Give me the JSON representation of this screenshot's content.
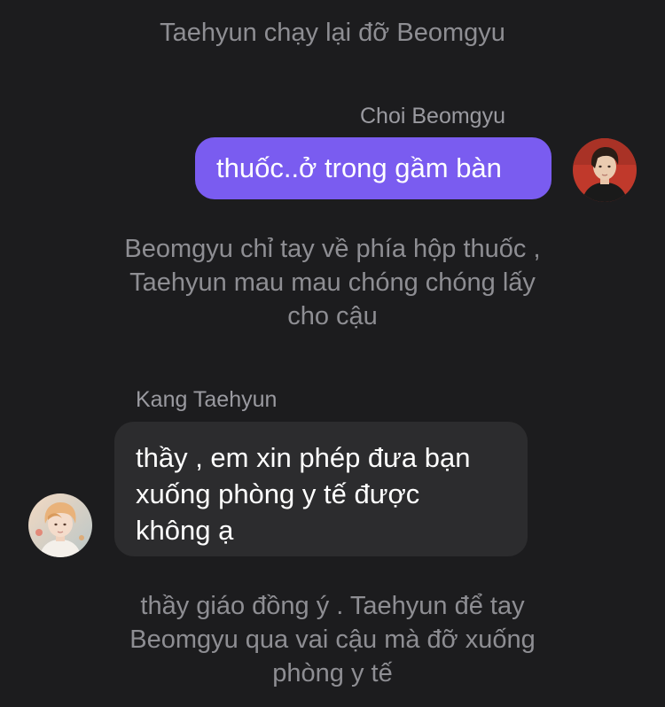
{
  "chat": {
    "narration_1": "Taehyun chạy lại đỡ Beomgyu",
    "message_1": {
      "sender": "Choi Beomgyu",
      "text": "thuốc..ở trong gầm bàn",
      "avatar_icon": "avatar-beomgyu"
    },
    "narration_2": "Beomgyu chỉ tay về phía hộp thuốc ,\nTaehyun mau mau chóng chóng lấy\ncho cậu",
    "message_2": {
      "sender": "Kang Taehyun",
      "text": "thầy , em xin phép đưa bạn\nxuống phòng y tế được\nkhông ạ",
      "avatar_icon": "avatar-taehyun"
    },
    "narration_3": "thầy giáo đồng ý . Taehyun để tay\nBeomgyu qua vai cậu mà đỡ xuống\nphòng y tế"
  },
  "colors": {
    "background": "#1c1c1e",
    "outgoing_bubble": "#7a5cf0",
    "incoming_bubble": "#2c2c2e",
    "narration_text": "#8e8e93",
    "sender_text": "#9a9aa0"
  }
}
